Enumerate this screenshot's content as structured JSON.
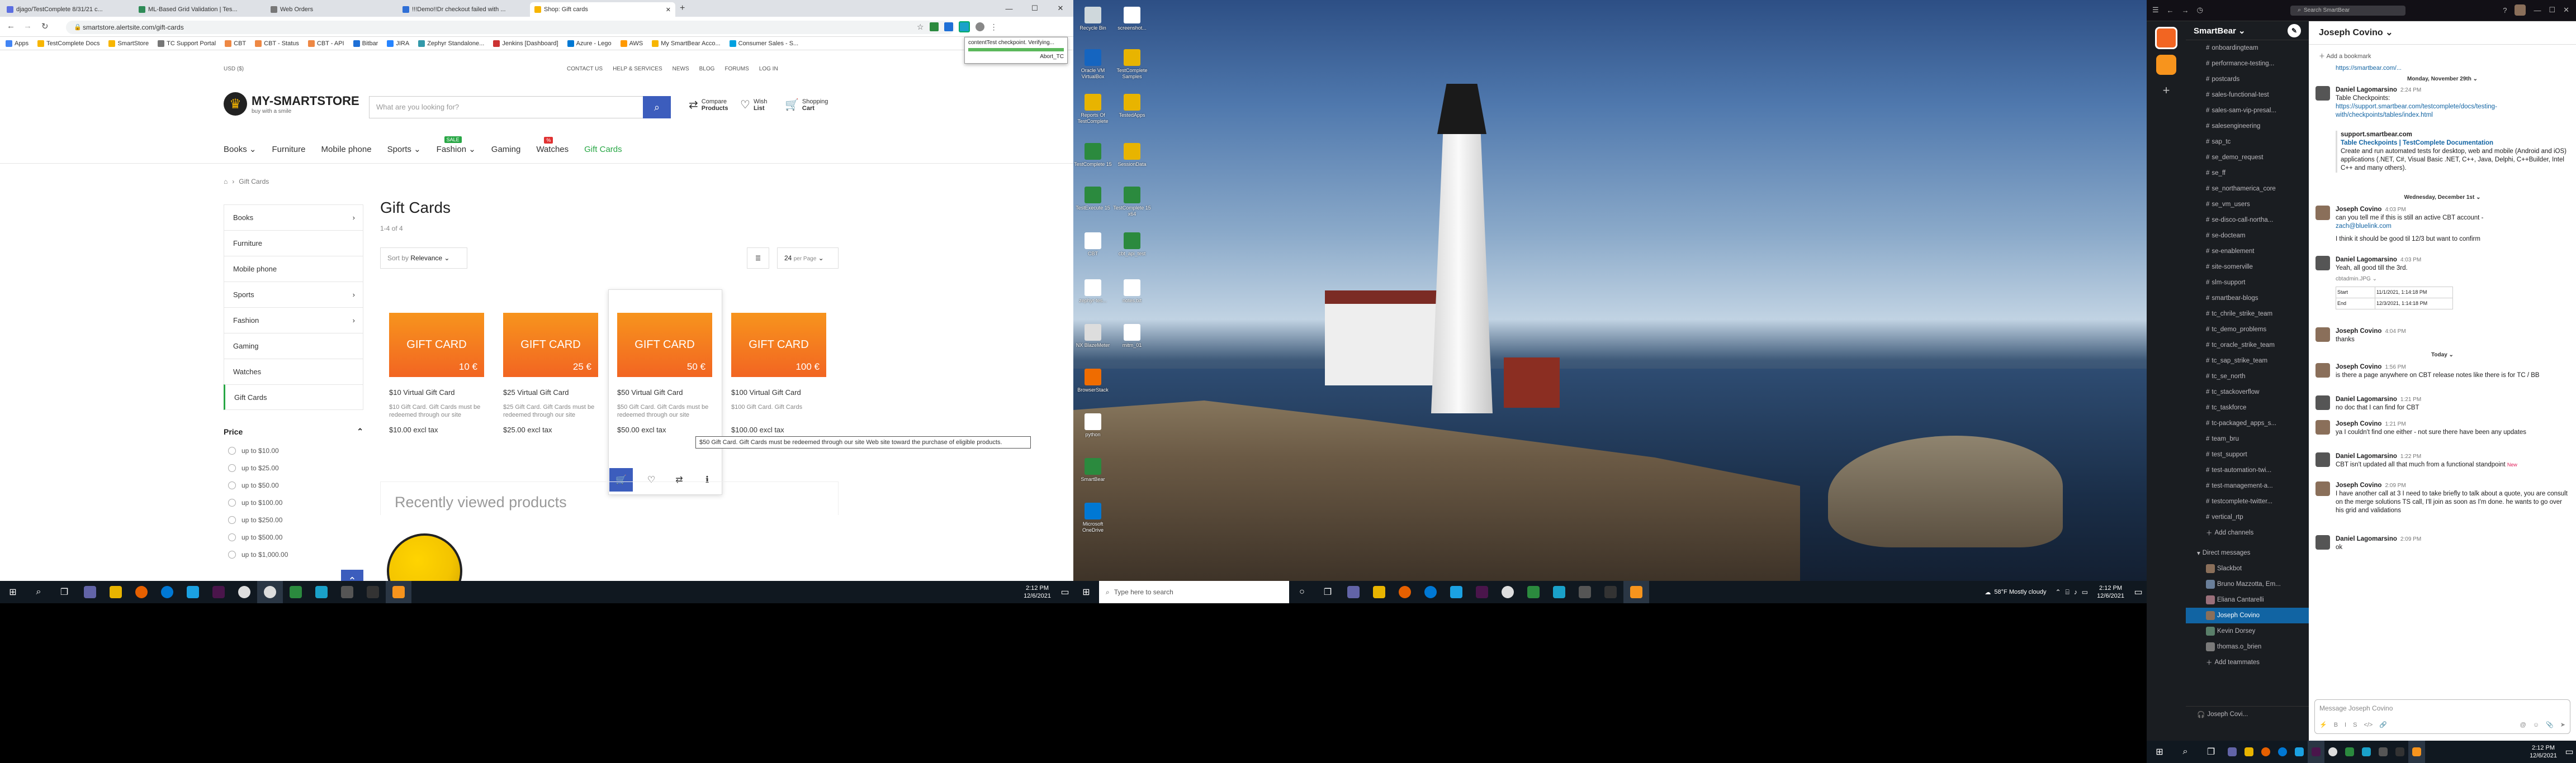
{
  "browser": {
    "tabs": [
      "djago/TestComplete 8/31/21 c...",
      "ML-Based Grid Validation | Tes...",
      "Web Orders",
      "!!!Demo!!Dr checkout failed with ...",
      "Shop: Gift cards"
    ],
    "active_tab": 4,
    "new_tab": "+",
    "url": "smartstore.alertsite.com/gift-cards",
    "bookmarks": [
      "Apps",
      "TestComplete Docs",
      "SmartStore",
      "TC Support Portal",
      "CBT",
      "CBT - Status",
      "CBT - API",
      "Bitbar",
      "JIRA",
      "Zephyr Standalone...",
      "Jenkins [Dashboard]",
      "Azure - Lego",
      "AWS",
      "My SmartBear Acco...",
      "Consumer Sales - S..."
    ],
    "ext_popup": {
      "title": "contentTest checkpoint. Verifying...",
      "status": "Abort_TC"
    }
  },
  "site": {
    "top_left": "USD ($)",
    "top_links": [
      "CONTACT US",
      "HELP & SERVICES",
      "NEWS",
      "BLOG",
      "FORUMS",
      "LOG IN"
    ],
    "logo": {
      "name": "MY-SMARTSTORE",
      "tagline": "buy with a smile"
    },
    "search_placeholder": "What are you looking for?",
    "header_icons": [
      {
        "l1": "Compare",
        "l2": "Products"
      },
      {
        "l1": "Wish",
        "l2": "List"
      },
      {
        "l1": "Shopping",
        "l2": "Cart"
      }
    ],
    "nav": [
      "Books",
      "Furniture",
      "Mobile phone",
      "Sports",
      "Fashion",
      "Gaming",
      "Watches",
      "Gift Cards"
    ],
    "nav_badges": {
      "fashion": "SALE",
      "watches": "%"
    },
    "breadcrumb": "Gift Cards",
    "sidebar": [
      "Books",
      "Furniture",
      "Mobile phone",
      "Sports",
      "Fashion",
      "Gaming",
      "Watches",
      "Gift Cards"
    ],
    "price_title": "Price",
    "price_filters": [
      "up to $10.00",
      "up to $25.00",
      "up to $50.00",
      "up to $100.00",
      "up to $250.00",
      "up to $500.00",
      "up to $1,000.00"
    ],
    "title": "Gift Cards",
    "count": "1-4 of 4",
    "sort": {
      "label": "Sort by",
      "value": "Relevance"
    },
    "per_page": {
      "value": "24",
      "label": "per Page"
    },
    "products": [
      {
        "badge": "GIFT CARD",
        "value": "10 €",
        "name": "$10 Virtual Gift Card",
        "desc": "$10 Gift Card. Gift Cards must be redeemed through our site",
        "price": "$10.00 excl tax"
      },
      {
        "badge": "GIFT CARD",
        "value": "25 €",
        "name": "$25 Virtual Gift Card",
        "desc": "$25 Gift Card. Gift Cards must be redeemed through our site",
        "price": "$25.00 excl tax"
      },
      {
        "badge": "GIFT CARD",
        "value": "50 €",
        "name": "$50 Virtual Gift Card",
        "desc": "$50 Gift Card. Gift Cards must be redeemed through our site",
        "price": "$50.00 excl tax"
      },
      {
        "badge": "GIFT CARD",
        "value": "100 €",
        "name": "$100 Virtual Gift Card",
        "desc": "$100 Gift Card. Gift Cards",
        "price": "$100.00 excl tax"
      }
    ],
    "tooltip": "$50 Gift Card. Gift Cards must be redeemed through our site Web site toward the purchase of eligible products.",
    "recent_title": "Recently viewed products"
  },
  "taskbar1": {
    "time": "2:12 PM",
    "date": "12/6/2021"
  },
  "taskbar2": {
    "search": "Type here to search",
    "weather": "58°F  Mostly cloudy",
    "time": "2:12 PM",
    "date": "12/6/2021"
  },
  "taskbar3": {
    "time": "2:12 PM",
    "date": "12/6/2021"
  },
  "desktop_icons": [
    "Recycle Bin",
    "screenshot...",
    "Oracle VM VirtualBox",
    "TestComplete Samples",
    "Reports Of TestComplete",
    "TestedApps",
    "TestComplete 15",
    "SessionData",
    "TestExecute 15",
    "TestComplete 15 x64",
    "CBT",
    "cbt_api_test",
    "zephyr-tes...",
    "notes.txt",
    "NX BlazeMeter",
    "mitm_01",
    "BrowserStack",
    "python",
    "SmartBear",
    "Microsoft OneDrive"
  ],
  "slack": {
    "search": "Search SmartBear",
    "workspace": "SmartBear",
    "channels": [
      "onboardingteam",
      "performance-testing...",
      "postcards",
      "sales-functional-test",
      "sales-sam-vip-presal...",
      "salesengineering",
      "sap_tc",
      "se_demo_request",
      "se_ff",
      "se_northamerica_core",
      "se_vm_users",
      "se-disco-call-northa...",
      "se-docteam",
      "se-enablement",
      "site-somerville",
      "slm-support",
      "smartbear-blogs",
      "tc_chrile_strike_team",
      "tc_demo_problems",
      "tc_oracle_strike_team",
      "tc_sap_strike_team",
      "tc_se_north",
      "tc_stackoverflow",
      "tc_taskforce",
      "tc-packaged_apps_s...",
      "team_bru",
      "test_support",
      "test-automation-twi...",
      "test-management-a...",
      "testcomplete-twitter...",
      "vertical_rtp"
    ],
    "add_channels": "Add channels",
    "dm_title": "Direct messages",
    "dms": [
      "Slackbot",
      "Bruno Mazzotta, Em...",
      "Eliana Cantarelli",
      "Joseph Covino",
      "Kevin Dorsey",
      "thomas.o_brien"
    ],
    "add_teammates": "Add teammates",
    "footer_user": "Joseph Covi...",
    "channel_title": "Joseph Covino",
    "add_bookmark": "Add a bookmark",
    "top_link": "https://smartbear.com/...",
    "days": [
      "Monday, November 29th",
      "Wednesday, December 1st",
      "Today"
    ],
    "messages": [
      {
        "who": "Daniel Lagomarsino",
        "ts": "2:24 PM",
        "text": "Table Checkpoints:",
        "link": "https://support.smartbear.com/testcomplete/docs/testing-with/checkpoints/tables/index.html"
      },
      {
        "who": "",
        "ts": "",
        "text": "support.smartbear.com",
        "link": "Table Checkpoints | TestComplete Documentation",
        "extra": "Create and run automated tests for desktop, web and mobile (Android and iOS) applications (.NET, C#, Visual Basic .NET, C++, Java, Delphi, C++Builder, Intel C++ and many others)."
      },
      {
        "who": "Joseph Covino",
        "ts": "4:03 PM",
        "text": "can you tell me if this is still an active CBT account -",
        "link": "zach@bluelink.com"
      },
      {
        "who": "",
        "ts": "",
        "text": "I think it should be good til 12/3 but want to confirm"
      },
      {
        "who": "Daniel Lagomarsino",
        "ts": "4:03 PM",
        "text": "Yeah, all good till the 3rd.",
        "file": "cbtadmin.JPG"
      },
      {
        "who": "Joseph Covino",
        "ts": "4:04 PM",
        "text": "thanks"
      },
      {
        "who": "Joseph Covino",
        "ts": "1:56 PM",
        "text": "is there a page anywhere on CBT release notes like there is for TC / BB"
      },
      {
        "who": "Daniel Lagomarsino",
        "ts": "1:21 PM",
        "text": "no doc that I can find for CBT"
      },
      {
        "who": "Joseph Covino",
        "ts": "1:21 PM",
        "text": "ya I couldn't find one either - not sure there have been any updates"
      },
      {
        "who": "Daniel Lagomarsino",
        "ts": "1:22 PM",
        "text": "CBT isn't updated all that much from a functional standpoint",
        "new": "New"
      },
      {
        "who": "Joseph Covino",
        "ts": "2:09 PM",
        "text": "I have another call at 3 I need to take briefly to talk about a quote, you are consult on the merge solutions TS call, I'll join as soon as I'm done. he wants to go over his grid and validations"
      },
      {
        "who": "Daniel Lagomarsino",
        "ts": "2:09 PM",
        "text": "ok"
      }
    ],
    "table": [
      [
        "Start",
        "11/1/2021, 1:14:18 PM"
      ],
      [
        "End",
        "12/3/2021, 1:14:18 PM"
      ]
    ],
    "composer_placeholder": "Message Joseph Covino"
  }
}
